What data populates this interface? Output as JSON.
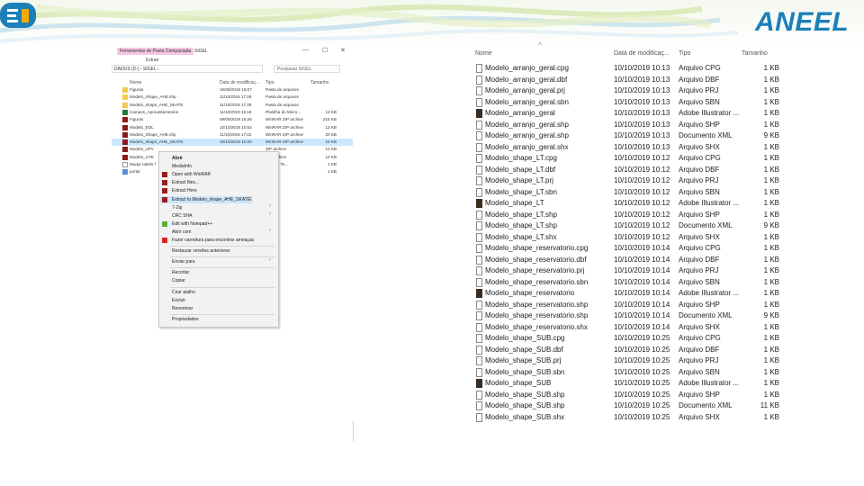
{
  "brand": {
    "name": "ANEEL",
    "color": "#1c7fb9",
    "accent": "#f5a800"
  },
  "explorer": {
    "ribbon_tab": "Ferramentas de Pasta Compactada",
    "ribbon_title": "SIGEL",
    "ribbon_sub": "Extrair",
    "win_controls": [
      "—",
      "☐",
      "✕"
    ],
    "address": "DADOS (D:)  ›  SIGEL  ›",
    "search_placeholder": "Pesquisar SIGEL",
    "columns": [
      "Nome",
      "Data de modificaç...",
      "Tipo",
      "Tamanho"
    ],
    "rows": [
      {
        "name": "Figuras",
        "date": "15/08/2019 16:07",
        "type": "Pasta de arquivos",
        "size": "",
        "icon": "folder"
      },
      {
        "name": "Modelo_Shape_AHE.shp",
        "date": "11/10/2019 17:26",
        "type": "Pasta de arquivos",
        "size": "",
        "icon": "folder"
      },
      {
        "name": "Modelo_shape_AHE_SKATE",
        "date": "11/10/2019 17:25",
        "type": "Pasta de arquivos",
        "size": "",
        "icon": "folder"
      },
      {
        "name": "Campos_Aproveitamentos",
        "date": "11/10/2019 15:18",
        "type": "Planilha do Micro...",
        "size": "13 KB",
        "icon": "xls"
      },
      {
        "name": "Figuras",
        "date": "09/08/2019 16:26",
        "type": "WinRAR ZIP archive",
        "size": "216 KB",
        "icon": "rar"
      },
      {
        "name": "Modelo_EOL",
        "date": "10/10/2019 10:54",
        "type": "WinRAR ZIP archive",
        "size": "12 KB",
        "icon": "rar"
      },
      {
        "name": "Modelo_Shape_AHE.shp",
        "date": "11/10/2019 17:22",
        "type": "WinRAR ZIP archive",
        "size": "20 KB",
        "icon": "rar"
      },
      {
        "name": "Modelo_shape_AHE_SKATE",
        "date": "10/10/2019 10:20",
        "type": "WinRAR ZIP archive",
        "size": "15 KB",
        "icon": "rar",
        "selected": true
      },
      {
        "name": "Modelo_UFV",
        "date": "",
        "type": "ZIP archive",
        "size": "12 KB",
        "icon": "rar"
      },
      {
        "name": "Modelo_UTE",
        "date": "",
        "type": "ZIP archive",
        "size": "12 KB",
        "icon": "rar"
      },
      {
        "name": "Mudar labels f",
        "date": "",
        "type": "ento de Te...",
        "size": "1 KB",
        "icon": "file"
      },
      {
        "name": "portal",
        "date": "",
        "type": "lo",
        "size": "1 KB",
        "icon": "lnk"
      }
    ]
  },
  "context_menu": [
    {
      "label": "Abrir",
      "bold": true
    },
    {
      "label": "MediaInfo"
    },
    {
      "label": "Open with WinRAR",
      "icon": "red"
    },
    {
      "label": "Extract files...",
      "icon": "red"
    },
    {
      "label": "Extract Here",
      "icon": "red"
    },
    {
      "label": "Extract to Modelo_shape_AHE_SKATE\\",
      "icon": "red",
      "highlight": true
    },
    {
      "label": "7-Zip",
      "arrow": true
    },
    {
      "label": "CRC SHA",
      "arrow": true
    },
    {
      "label": "Edit with Notepad++",
      "icon": "np"
    },
    {
      "label": "Abrir com",
      "arrow": true
    },
    {
      "label": "Fazer varredura para encontrar ameaças",
      "icon": "mcafee"
    },
    {
      "label": "Restaurar versões anteriores",
      "sep_before": true
    },
    {
      "label": "Enviar para",
      "arrow": true,
      "sep_before": true
    },
    {
      "label": "Recortar",
      "sep_before": true
    },
    {
      "label": "Copiar"
    },
    {
      "label": "Criar atalho",
      "sep_before": true
    },
    {
      "label": "Excluir"
    },
    {
      "label": "Renomear"
    },
    {
      "label": "Propriedades",
      "sep_before": true
    }
  ],
  "filelist": {
    "columns": [
      "Nome",
      "Data de modificaç...",
      "Tipo",
      "Tamanho"
    ],
    "rows": [
      {
        "name": "Modelo_arranjo_geral.cpg",
        "date": "10/10/2019 10:13",
        "type": "Arquivo CPG",
        "size": "1 KB"
      },
      {
        "name": "Modelo_arranjo_geral.dbf",
        "date": "10/10/2019 10:13",
        "type": "Arquivo DBF",
        "size": "1 KB"
      },
      {
        "name": "Modelo_arranjo_geral.prj",
        "date": "10/10/2019 10:13",
        "type": "Arquivo PRJ",
        "size": "1 KB"
      },
      {
        "name": "Modelo_arranjo_geral.sbn",
        "date": "10/10/2019 10:13",
        "type": "Arquivo SBN",
        "size": "1 KB"
      },
      {
        "name": "Modelo_arranjo_geral",
        "date": "10/10/2019 10:13",
        "type": "Adobe Illustrator ...",
        "size": "1 KB",
        "ai": true
      },
      {
        "name": "Modelo_arranjo_geral.shp",
        "date": "10/10/2019 10:13",
        "type": "Arquivo SHP",
        "size": "1 KB"
      },
      {
        "name": "Modelo_arranjo_geral.shp",
        "date": "10/10/2019 10:13",
        "type": "Documento XML",
        "size": "9 KB"
      },
      {
        "name": "Modelo_arranjo_geral.shx",
        "date": "10/10/2019 10:13",
        "type": "Arquivo SHX",
        "size": "1 KB"
      },
      {
        "name": "Modelo_shape_LT.cpg",
        "date": "10/10/2019 10:12",
        "type": "Arquivo CPG",
        "size": "1 KB"
      },
      {
        "name": "Modelo_shape_LT.dbf",
        "date": "10/10/2019 10:12",
        "type": "Arquivo DBF",
        "size": "1 KB"
      },
      {
        "name": "Modelo_shape_LT.prj",
        "date": "10/10/2019 10:12",
        "type": "Arquivo PRJ",
        "size": "1 KB"
      },
      {
        "name": "Modelo_shape_LT.sbn",
        "date": "10/10/2019 10:12",
        "type": "Arquivo SBN",
        "size": "1 KB"
      },
      {
        "name": "Modelo_shape_LT",
        "date": "10/10/2019 10:12",
        "type": "Adobe Illustrator ...",
        "size": "1 KB",
        "ai": true
      },
      {
        "name": "Modelo_shape_LT.shp",
        "date": "10/10/2019 10:12",
        "type": "Arquivo SHP",
        "size": "1 KB"
      },
      {
        "name": "Modelo_shape_LT.shp",
        "date": "10/10/2019 10:12",
        "type": "Documento XML",
        "size": "9 KB"
      },
      {
        "name": "Modelo_shape_LT.shx",
        "date": "10/10/2019 10:12",
        "type": "Arquivo SHX",
        "size": "1 KB"
      },
      {
        "name": "Modelo_shape_reservatorio.cpg",
        "date": "10/10/2019 10:14",
        "type": "Arquivo CPG",
        "size": "1 KB"
      },
      {
        "name": "Modelo_shape_reservatorio.dbf",
        "date": "10/10/2019 10:14",
        "type": "Arquivo DBF",
        "size": "1 KB"
      },
      {
        "name": "Modelo_shape_reservatorio.prj",
        "date": "10/10/2019 10:14",
        "type": "Arquivo PRJ",
        "size": "1 KB"
      },
      {
        "name": "Modelo_shape_reservatorio.sbn",
        "date": "10/10/2019 10:14",
        "type": "Arquivo SBN",
        "size": "1 KB"
      },
      {
        "name": "Modelo_shape_reservatorio",
        "date": "10/10/2019 10:14",
        "type": "Adobe Illustrator ...",
        "size": "1 KB",
        "ai": true
      },
      {
        "name": "Modelo_shape_reservatorio.shp",
        "date": "10/10/2019 10:14",
        "type": "Arquivo SHP",
        "size": "1 KB"
      },
      {
        "name": "Modelo_shape_reservatorio.shp",
        "date": "10/10/2019 10:14",
        "type": "Documento XML",
        "size": "9 KB"
      },
      {
        "name": "Modelo_shape_reservatorio.shx",
        "date": "10/10/2019 10:14",
        "type": "Arquivo SHX",
        "size": "1 KB"
      },
      {
        "name": "Modelo_shape_SUB.cpg",
        "date": "10/10/2019 10:25",
        "type": "Arquivo CPG",
        "size": "1 KB"
      },
      {
        "name": "Modelo_shape_SUB.dbf",
        "date": "10/10/2019 10:25",
        "type": "Arquivo DBF",
        "size": "1 KB"
      },
      {
        "name": "Modelo_shape_SUB.prj",
        "date": "10/10/2019 10:25",
        "type": "Arquivo PRJ",
        "size": "1 KB"
      },
      {
        "name": "Modelo_shape_SUB.sbn",
        "date": "10/10/2019 10:25",
        "type": "Arquivo SBN",
        "size": "1 KB"
      },
      {
        "name": "Modelo_shape_SUB",
        "date": "10/10/2019 10:25",
        "type": "Adobe Illustrator ...",
        "size": "1 KB",
        "ai": true
      },
      {
        "name": "Modelo_shape_SUB.shp",
        "date": "10/10/2019 10:25",
        "type": "Arquivo SHP",
        "size": "1 KB"
      },
      {
        "name": "Modelo_shape_SUB.shp",
        "date": "10/10/2019 10:25",
        "type": "Documento XML",
        "size": "11 KB"
      },
      {
        "name": "Modelo_shape_SUB.shx",
        "date": "10/10/2019 10:25",
        "type": "Arquivo SHX",
        "size": "1 KB"
      }
    ]
  }
}
